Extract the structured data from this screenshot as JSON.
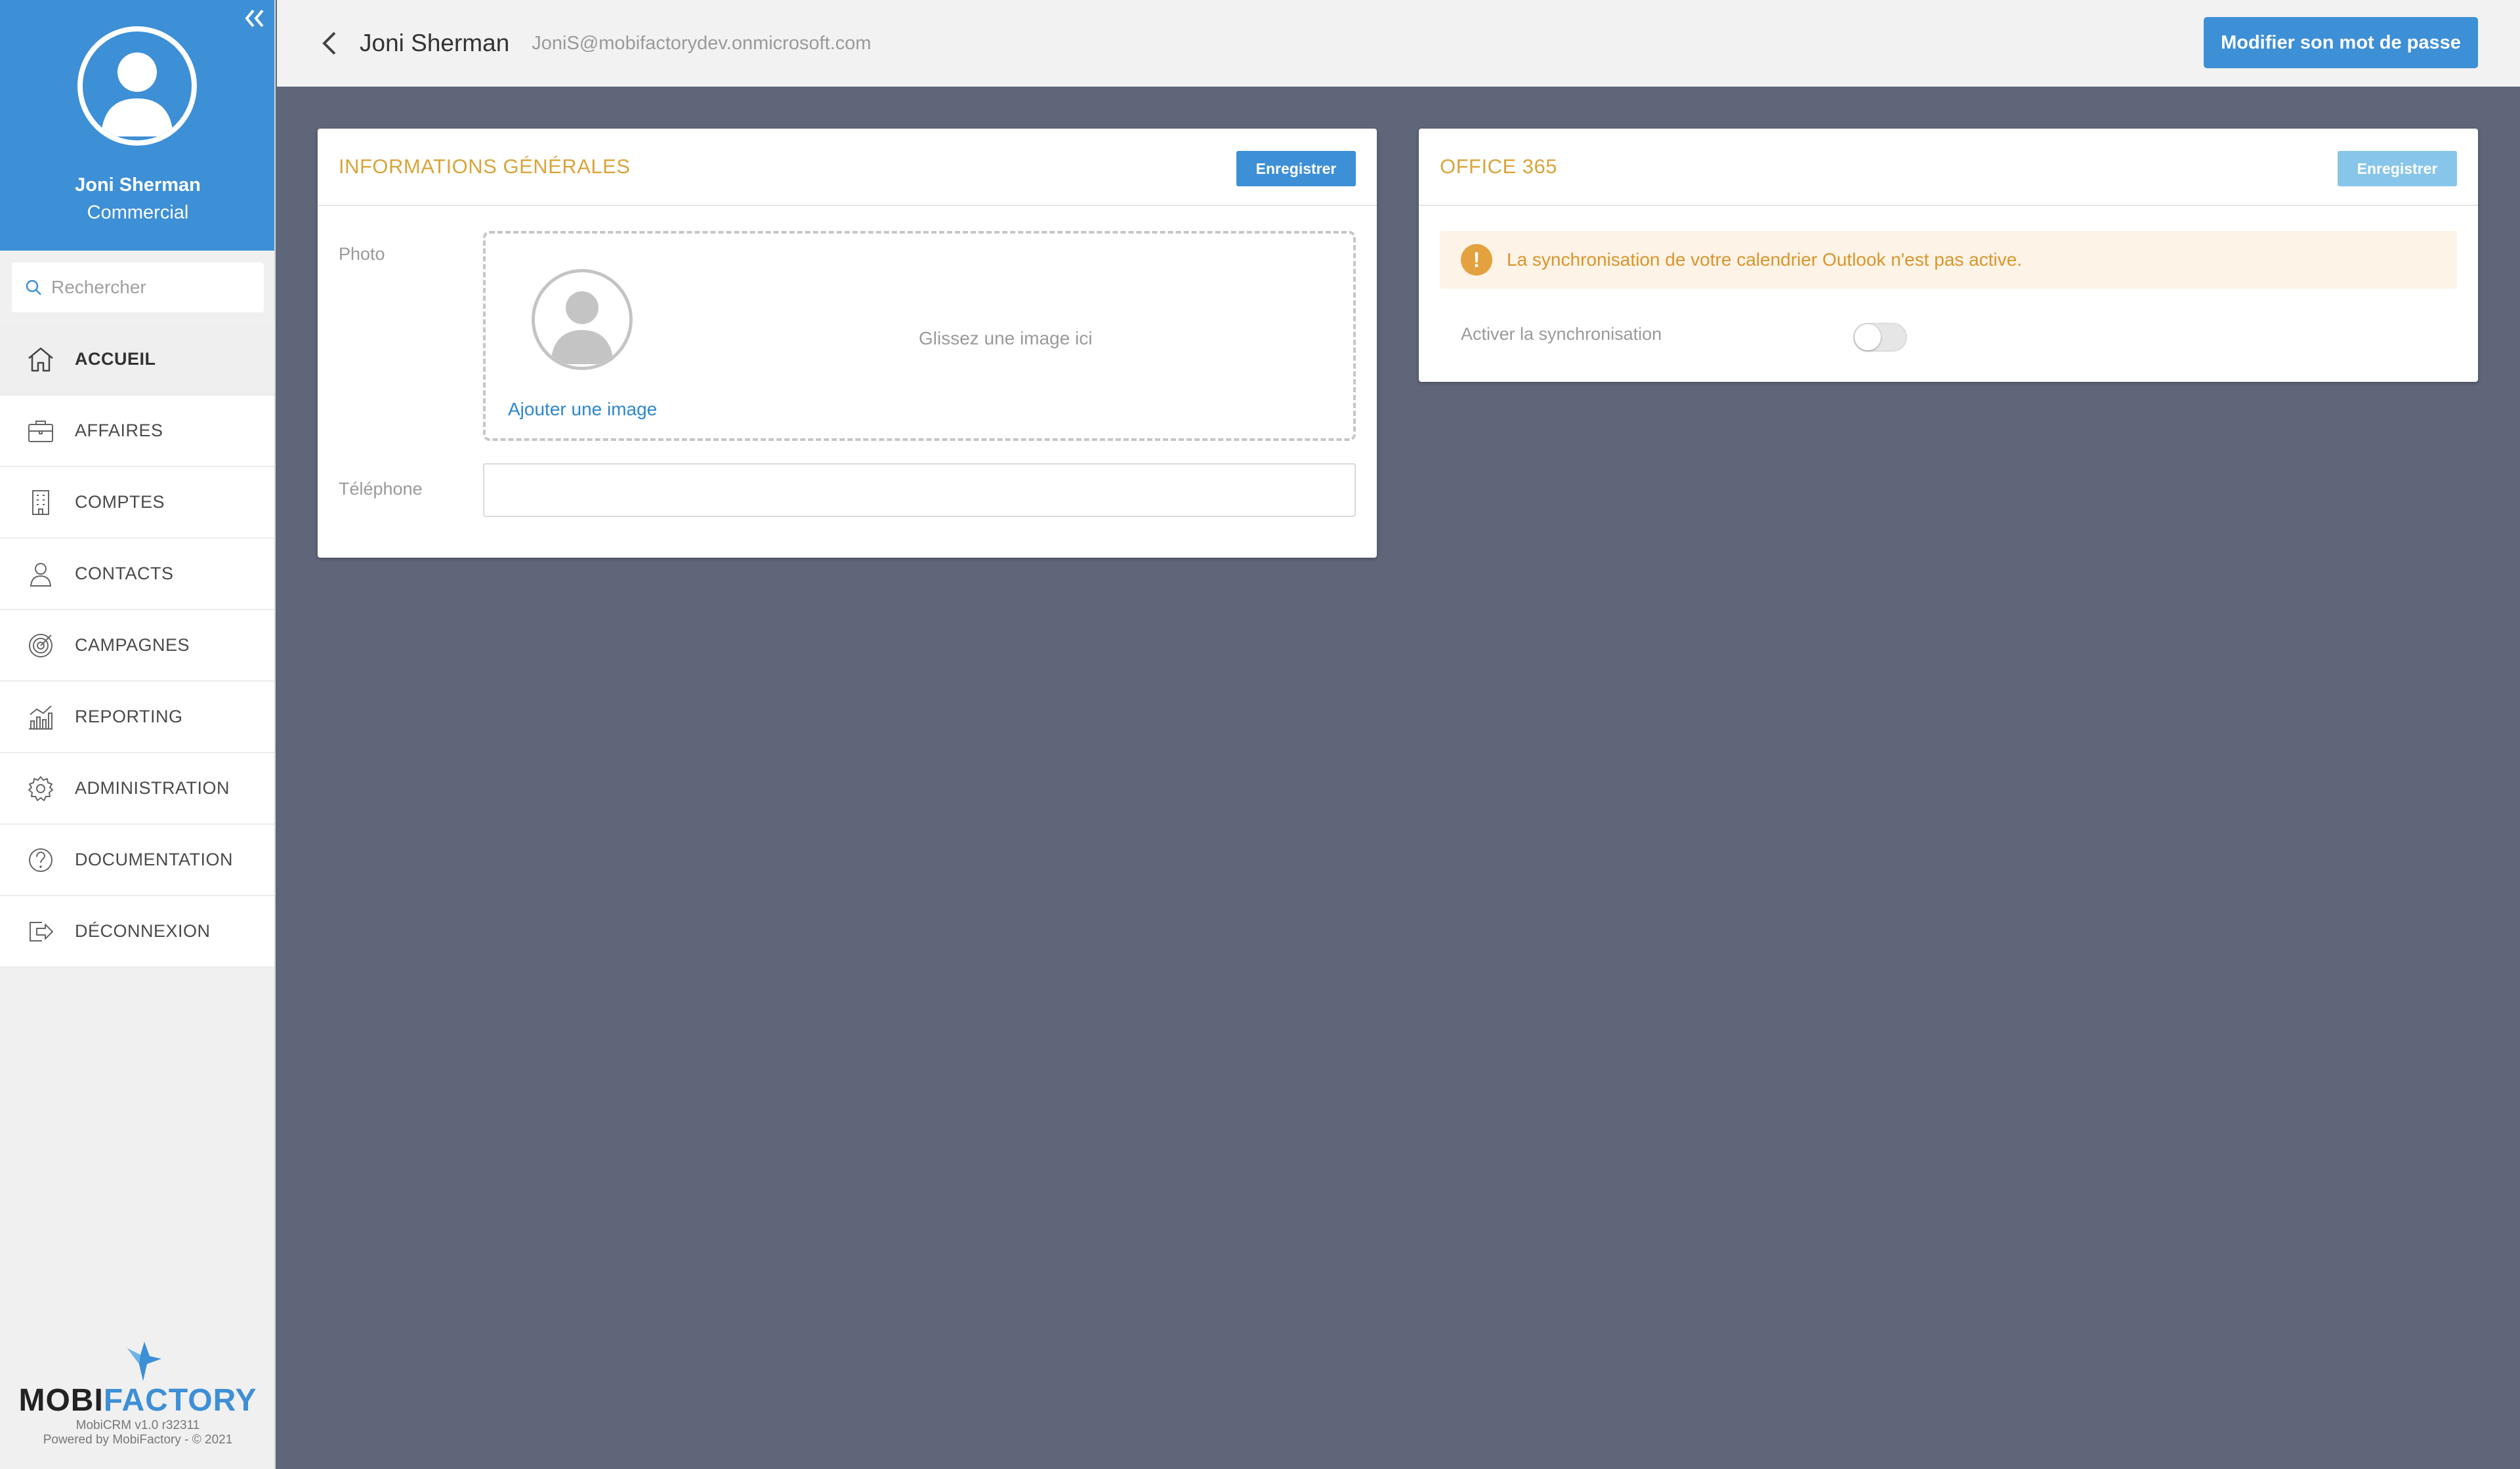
{
  "sidebar": {
    "collapse_icon": "double-chevron-left-icon",
    "profile": {
      "name": "Joni Sherman",
      "role": "Commercial"
    },
    "search": {
      "placeholder": "Rechercher"
    },
    "items": [
      {
        "label": "ACCUEIL",
        "icon": "home-icon",
        "active": true
      },
      {
        "label": "AFFAIRES",
        "icon": "briefcase-icon"
      },
      {
        "label": "COMPTES",
        "icon": "building-icon"
      },
      {
        "label": "CONTACTS",
        "icon": "person-icon"
      },
      {
        "label": "CAMPAGNES",
        "icon": "target-icon"
      },
      {
        "label": "REPORTING",
        "icon": "chart-icon"
      },
      {
        "label": "ADMINISTRATION",
        "icon": "gear-icon"
      },
      {
        "label": "DOCUMENTATION",
        "icon": "help-icon"
      },
      {
        "label": "DÉCONNEXION",
        "icon": "logout-icon"
      }
    ],
    "brand": {
      "logo_part1": "MOBI",
      "logo_part2": "FACTORY",
      "version": "MobiCRM v1.0 r32311",
      "powered": "Powered by MobiFactory - © 2021"
    }
  },
  "header": {
    "name": "Joni Sherman",
    "email": "JoniS@mobifactorydev.onmicrosoft.com",
    "change_password_label": "Modifier son mot de passe"
  },
  "general": {
    "title": "INFORMATIONS GÉNÉRALES",
    "save_label": "Enregistrer",
    "photo_label": "Photo",
    "add_image_label": "Ajouter une image",
    "drop_hint": "Glissez une image ici",
    "phone_label": "Téléphone",
    "phone_value": ""
  },
  "office": {
    "title": "OFFICE 365",
    "save_label": "Enregistrer",
    "alert_text": "La synchronisation de votre calendrier Outlook n'est pas active.",
    "sync_label": "Activer la synchronisation",
    "sync_enabled": false
  },
  "colors": {
    "accent": "#3d8fd6",
    "title": "#d9a43a",
    "background": "#5f6679",
    "alert_bg": "#fdf3e6",
    "alert_text": "#d9952c"
  }
}
